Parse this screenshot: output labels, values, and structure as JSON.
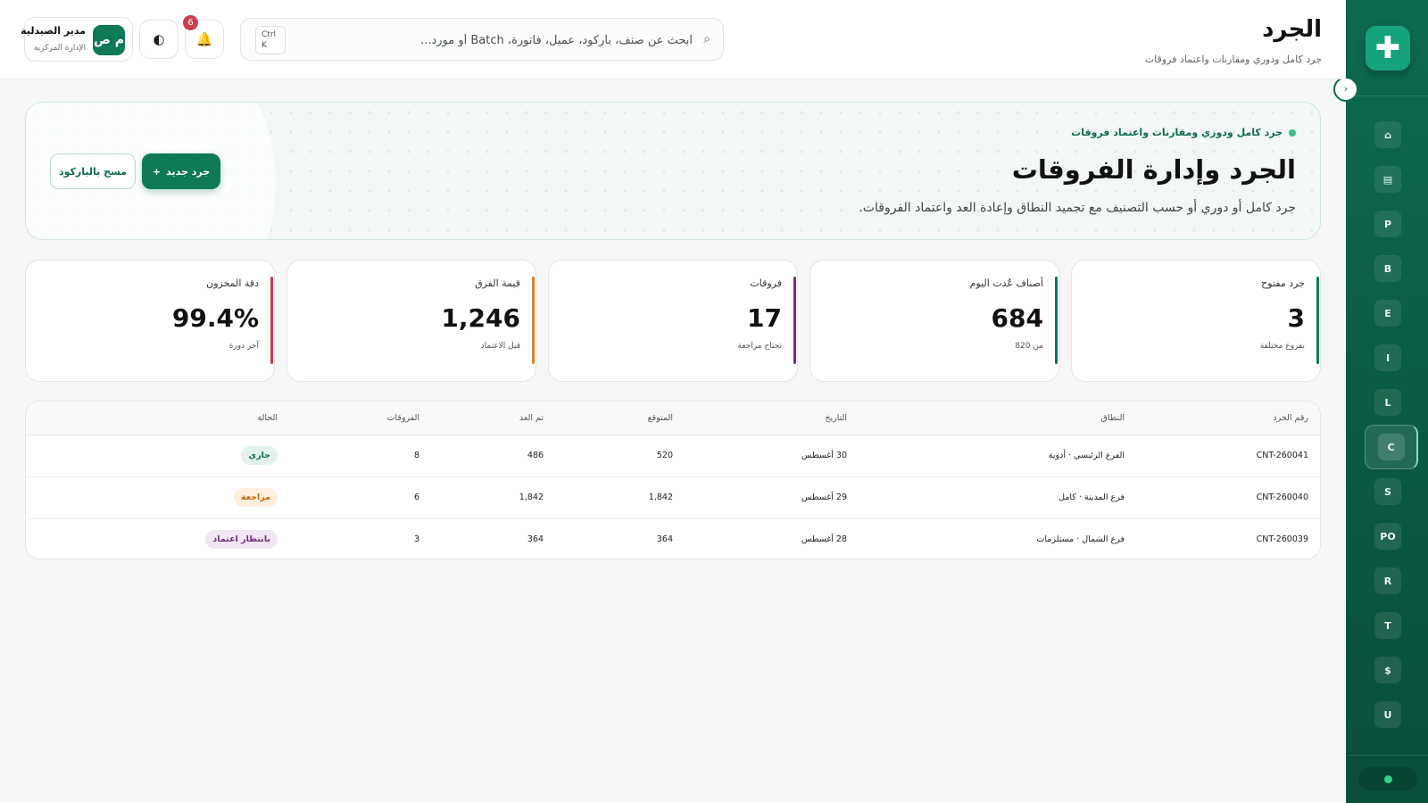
{
  "header": {
    "title": "الجرد",
    "subtitle": "جرد كامل ودوري ومقارنات واعتماد فروقات",
    "search_placeholder": "ابحث عن صنف، باركود، عميل، فاتورة، Batch أو مورد...",
    "shortcut_line1": "Ctrl",
    "shortcut_line2": "K",
    "notifications_count": "6",
    "user": {
      "initials": "م ص",
      "name": "مدير الصيدلية",
      "role": "الإدارة المركزية"
    }
  },
  "sidebar": {
    "logo": "✚",
    "toggle": "›",
    "items": [
      {
        "label": "⌂"
      },
      {
        "label": "▤"
      },
      {
        "label": "P"
      },
      {
        "label": "B"
      },
      {
        "label": "E"
      },
      {
        "label": "I"
      },
      {
        "label": "L"
      },
      {
        "label": "C"
      },
      {
        "label": "S"
      },
      {
        "label": "PO"
      },
      {
        "label": "R"
      },
      {
        "label": "T"
      },
      {
        "label": "$"
      },
      {
        "label": "U"
      }
    ],
    "active_index": 7
  },
  "hero": {
    "tag": "جرد كامل ودوري ومقارنات واعتماد فروقات",
    "title": "الجرد وإدارة الفروقات",
    "description": "جرد كامل أو دوري أو حسب التصنيف مع تجميد النطاق وإعادة العد واعتماد الفروقات.",
    "primary_button": "جرد جديد",
    "primary_icon": "+",
    "secondary_button": "مسح بالباركود"
  },
  "stats": [
    {
      "label": "جرد مفتوح",
      "value": "3",
      "sub": "بفروع مختلفة",
      "color": "#0e7a58"
    },
    {
      "label": "أصناف عُدت اليوم",
      "value": "684",
      "sub": "من 820",
      "color": "#0e6f63"
    },
    {
      "label": "فروقات",
      "value": "17",
      "sub": "تحتاج مراجعة",
      "color": "#6d2f7a"
    },
    {
      "label": "قيمة الفرق",
      "value": "1,246",
      "sub": "قبل الاعتماد",
      "color": "#d9822b"
    },
    {
      "label": "دقة المخزون",
      "value": "99.4%",
      "sub": "آخر دورة",
      "color": "#c9404c"
    }
  ],
  "table": {
    "columns": [
      "رقم الجرد",
      "النطاق",
      "التاريخ",
      "المتوقع",
      "تم العد",
      "الفروقات",
      "الحالة"
    ],
    "rows": [
      {
        "id": "CNT-260041",
        "scope": "الفرع الرئيسي · أدوية",
        "date": "30 أغسطس",
        "expected": "520",
        "counted": "486",
        "diff": "8",
        "status": "جاري",
        "status_color": "#0e6a4f",
        "status_bg": "#e2f3ec"
      },
      {
        "id": "CNT-260040",
        "scope": "فرع المدينة · كامل",
        "date": "29 أغسطس",
        "expected": "1,842",
        "counted": "1,842",
        "diff": "6",
        "status": "مراجعة",
        "status_color": "#c2680e",
        "status_bg": "#fdeedd"
      },
      {
        "id": "CNT-260039",
        "scope": "فرع الشمال · مستلزمات",
        "date": "28 أغسطس",
        "expected": "364",
        "counted": "364",
        "diff": "3",
        "status": "بانتظار اعتماد",
        "status_color": "#6d2f7a",
        "status_bg": "#f1e6f3"
      }
    ]
  }
}
